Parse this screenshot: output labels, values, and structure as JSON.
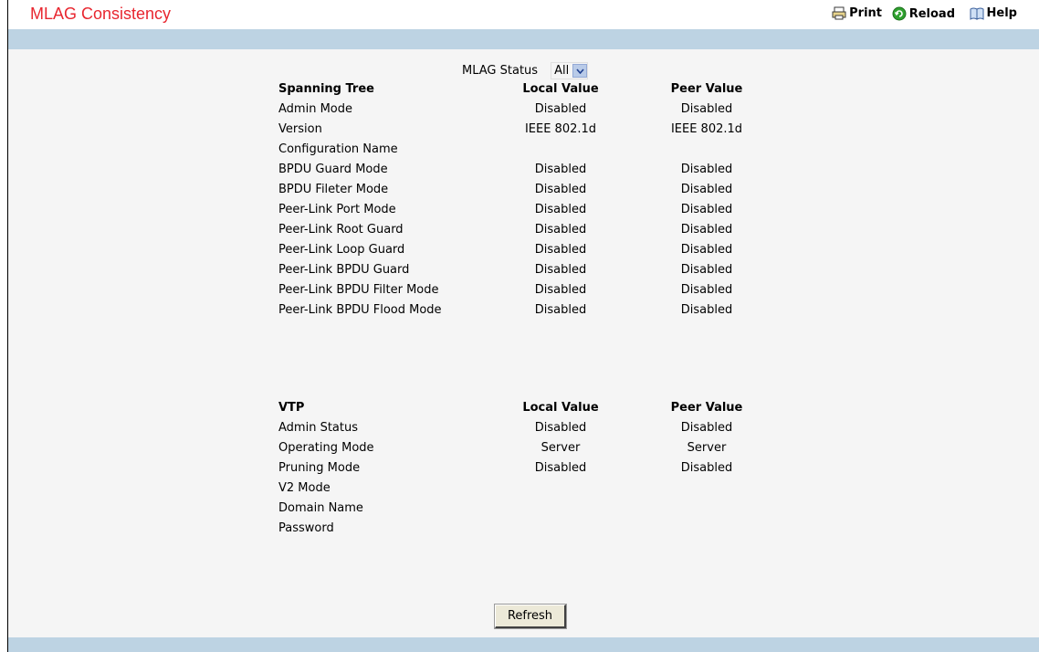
{
  "header": {
    "title": "MLAG Consistency",
    "print_label": "Print",
    "reload_label": "Reload",
    "help_label": "Help"
  },
  "filter": {
    "label": "MLAG Status",
    "selected": "All"
  },
  "spanning_tree": {
    "heading": "Spanning Tree",
    "local_heading": "Local Value",
    "peer_heading": "Peer Value",
    "rows": [
      {
        "label": "Admin Mode",
        "local": "Disabled",
        "peer": "Disabled"
      },
      {
        "label": "Version",
        "local": "IEEE 802.1d",
        "peer": "IEEE 802.1d"
      },
      {
        "label": "Configuration Name",
        "local": "",
        "peer": ""
      },
      {
        "label": "BPDU Guard Mode",
        "local": "Disabled",
        "peer": "Disabled"
      },
      {
        "label": "BPDU Fileter Mode",
        "local": "Disabled",
        "peer": "Disabled"
      },
      {
        "label": "Peer-Link Port Mode",
        "local": "Disabled",
        "peer": "Disabled"
      },
      {
        "label": "Peer-Link Root Guard",
        "local": "Disabled",
        "peer": "Disabled"
      },
      {
        "label": "Peer-Link Loop Guard",
        "local": "Disabled",
        "peer": "Disabled"
      },
      {
        "label": "Peer-Link BPDU Guard",
        "local": "Disabled",
        "peer": "Disabled"
      },
      {
        "label": "Peer-Link BPDU Filter Mode",
        "local": "Disabled",
        "peer": "Disabled"
      },
      {
        "label": "Peer-Link BPDU Flood Mode",
        "local": "Disabled",
        "peer": "Disabled"
      }
    ]
  },
  "vtp": {
    "heading": "VTP",
    "local_heading": "Local Value",
    "peer_heading": "Peer Value",
    "rows": [
      {
        "label": "Admin Status",
        "local": "Disabled",
        "peer": "Disabled"
      },
      {
        "label": "Operating Mode",
        "local": "Server",
        "peer": "Server"
      },
      {
        "label": "Pruning Mode",
        "local": "Disabled",
        "peer": "Disabled"
      },
      {
        "label": "V2 Mode",
        "local": "",
        "peer": ""
      },
      {
        "label": "Domain Name",
        "local": "",
        "peer": ""
      },
      {
        "label": "Password",
        "local": "",
        "peer": ""
      }
    ]
  },
  "actions": {
    "refresh_label": "Refresh"
  }
}
